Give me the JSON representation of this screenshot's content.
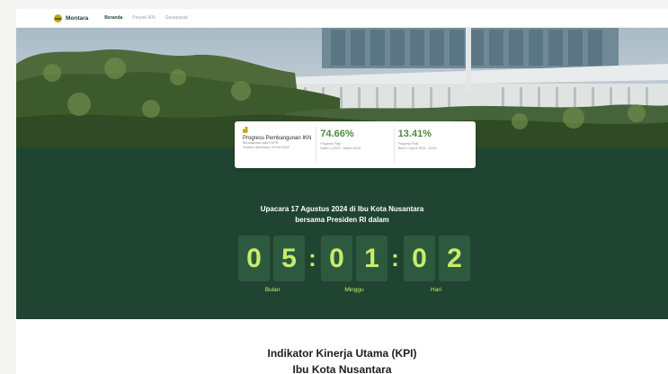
{
  "nav": {
    "logo_text": "Montara",
    "links": [
      "Beranda",
      "Proyek IKN",
      "Geospasial"
    ]
  },
  "progress_card": {
    "title": "Progress Pembangunan IKN",
    "source": "Berdasarkan data PUPR",
    "updated": "Terakhir diperbarui: 28 Mei 2024",
    "items": [
      {
        "value": "74.66%",
        "label": "Progress Fisik",
        "period": "Batch 1 (2022 - Maret 2023)"
      },
      {
        "value": "13.41%",
        "label": "Progress Fisik",
        "period": "Batch 2 (April 2023 - 2024)"
      }
    ]
  },
  "countdown": {
    "title_line1": "Upacara 17 Agustus 2024 di Ibu Kota Nusantara",
    "title_line2": "bersama Presiden RI dalam",
    "digits": [
      "0",
      "5",
      "0",
      "1",
      "0",
      "2"
    ],
    "separator": ":",
    "units": [
      "Bulan",
      "Minggu",
      "Hari"
    ]
  },
  "kpi": {
    "line1": "Indikator Kinerja Utama (KPI)",
    "line2": "Ibu Kota Nusantara"
  },
  "colors": {
    "dark_green": "#1f4432",
    "digit_bg": "#2d5a3e",
    "accent_lime": "#c6ec6f",
    "percent_green": "#4a8f3c"
  }
}
